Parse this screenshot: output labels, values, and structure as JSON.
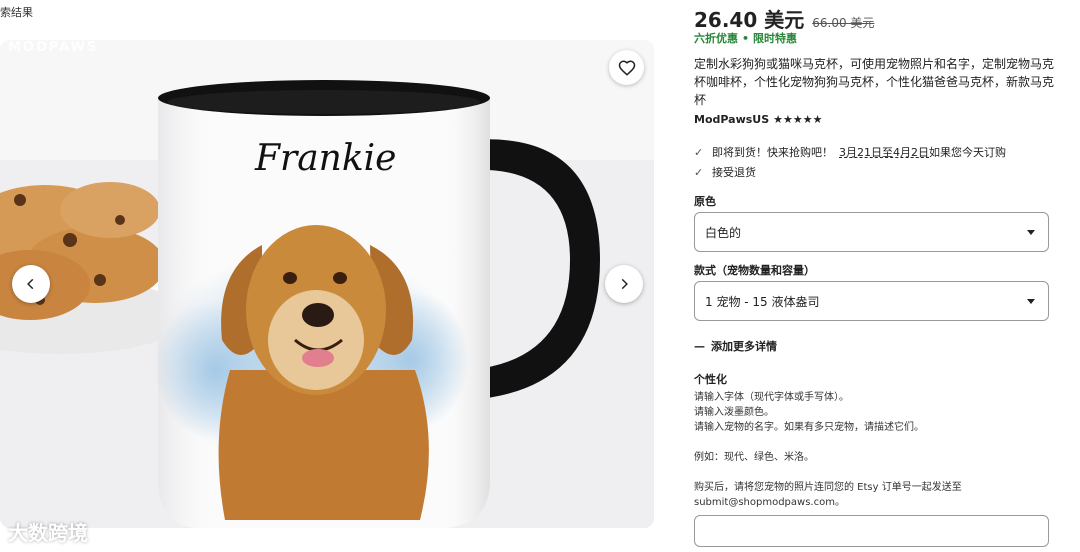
{
  "breadcrumb": "索结果",
  "gallery": {
    "watermark": "MODPAWS",
    "mug_name": "Frankie",
    "logo_text": "大数跨境"
  },
  "product": {
    "price": "26.40 美元",
    "original_price": "66.00 美元",
    "promo_discount": "六折优惠",
    "promo_dot": "•",
    "promo_limited": "限时特惠",
    "title": "定制水彩狗狗或猫咪马克杯，可使用宠物照片和名字，定制宠物马克杯咖啡杯，个性化宠物狗狗马克杯，个性化猫爸爸马克杯，新款马克杯",
    "shop_name": "ModPawsUS",
    "rating_stars": "★★★★★",
    "perks": {
      "delivery_prefix": "即将到货！快来抢购吧！",
      "delivery_dates": "3月21日至4月2日",
      "delivery_suffix": "如果您今天订购",
      "returns": "接受退货"
    }
  },
  "options": {
    "color_label": "原色",
    "color_value": "白色的",
    "style_label": "款式（宠物数量和容量）",
    "style_value": "1 宠物 - 15 液体盎司",
    "more_details": "添加更多详情"
  },
  "personalization": {
    "title": "个性化",
    "lines": [
      "请输入字体（现代字体或手写体）。",
      "请输入泼墨颜色。",
      "请输入宠物的名字。如果有多只宠物，请描述它们。"
    ],
    "example": "例如：现代、绿色、米洛。",
    "after_purchase_1": "购买后，请将您宠物的照片连同您的 Etsy 订单号一起发送至",
    "after_purchase_2": "submit@shopmodpaws.com。"
  },
  "colors": {
    "promo_green": "#258635",
    "mug_rim": "#111111",
    "splash_blue": "#9cc4e4",
    "dog_fur": "#c98a3c"
  }
}
